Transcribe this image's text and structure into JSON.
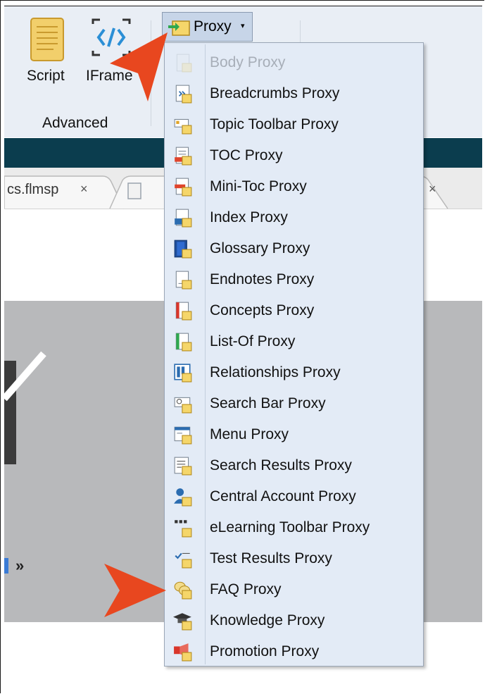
{
  "ribbon": {
    "script_label": "Script",
    "iframe_label": "IFrame",
    "group_label": "Advanced",
    "proxy_button_label": "Proxy",
    "proxy_caret": "▾"
  },
  "tabs": {
    "tab1_label": "cs.flmsp",
    "close_glyph": "×"
  },
  "content": {
    "chevron": "»"
  },
  "menu": {
    "items": [
      {
        "label": "Body Proxy",
        "icon": "body-proxy-icon",
        "enabled": false
      },
      {
        "label": "Breadcrumbs Proxy",
        "icon": "breadcrumbs-proxy-icon",
        "enabled": true
      },
      {
        "label": "Topic Toolbar Proxy",
        "icon": "topic-toolbar-proxy-icon",
        "enabled": true
      },
      {
        "label": "TOC Proxy",
        "icon": "toc-proxy-icon",
        "enabled": true
      },
      {
        "label": "Mini-Toc Proxy",
        "icon": "mini-toc-proxy-icon",
        "enabled": true
      },
      {
        "label": "Index Proxy",
        "icon": "index-proxy-icon",
        "enabled": true
      },
      {
        "label": "Glossary Proxy",
        "icon": "glossary-proxy-icon",
        "enabled": true
      },
      {
        "label": "Endnotes Proxy",
        "icon": "endnotes-proxy-icon",
        "enabled": true
      },
      {
        "label": "Concepts Proxy",
        "icon": "concepts-proxy-icon",
        "enabled": true
      },
      {
        "label": "List-Of Proxy",
        "icon": "list-of-proxy-icon",
        "enabled": true
      },
      {
        "label": "Relationships Proxy",
        "icon": "relationships-proxy-icon",
        "enabled": true
      },
      {
        "label": "Search Bar Proxy",
        "icon": "search-bar-proxy-icon",
        "enabled": true
      },
      {
        "label": "Menu Proxy",
        "icon": "menu-proxy-icon",
        "enabled": true
      },
      {
        "label": "Search Results Proxy",
        "icon": "search-results-proxy-icon",
        "enabled": true
      },
      {
        "label": "Central Account Proxy",
        "icon": "central-account-proxy-icon",
        "enabled": true
      },
      {
        "label": "eLearning Toolbar Proxy",
        "icon": "elearning-toolbar-proxy-icon",
        "enabled": true
      },
      {
        "label": "Test Results Proxy",
        "icon": "test-results-proxy-icon",
        "enabled": true
      },
      {
        "label": "FAQ Proxy",
        "icon": "faq-proxy-icon",
        "enabled": true
      },
      {
        "label": "Knowledge Proxy",
        "icon": "knowledge-proxy-icon",
        "enabled": true
      },
      {
        "label": "Promotion Proxy",
        "icon": "promotion-proxy-icon",
        "enabled": true
      }
    ]
  },
  "colors": {
    "callout_arrow": "#e8471f",
    "menu_background": "#e3ebf6",
    "ribbon_background": "#e9eef5",
    "header_band": "#0b3d4e",
    "proxy_yellow": "#f5d66a"
  }
}
